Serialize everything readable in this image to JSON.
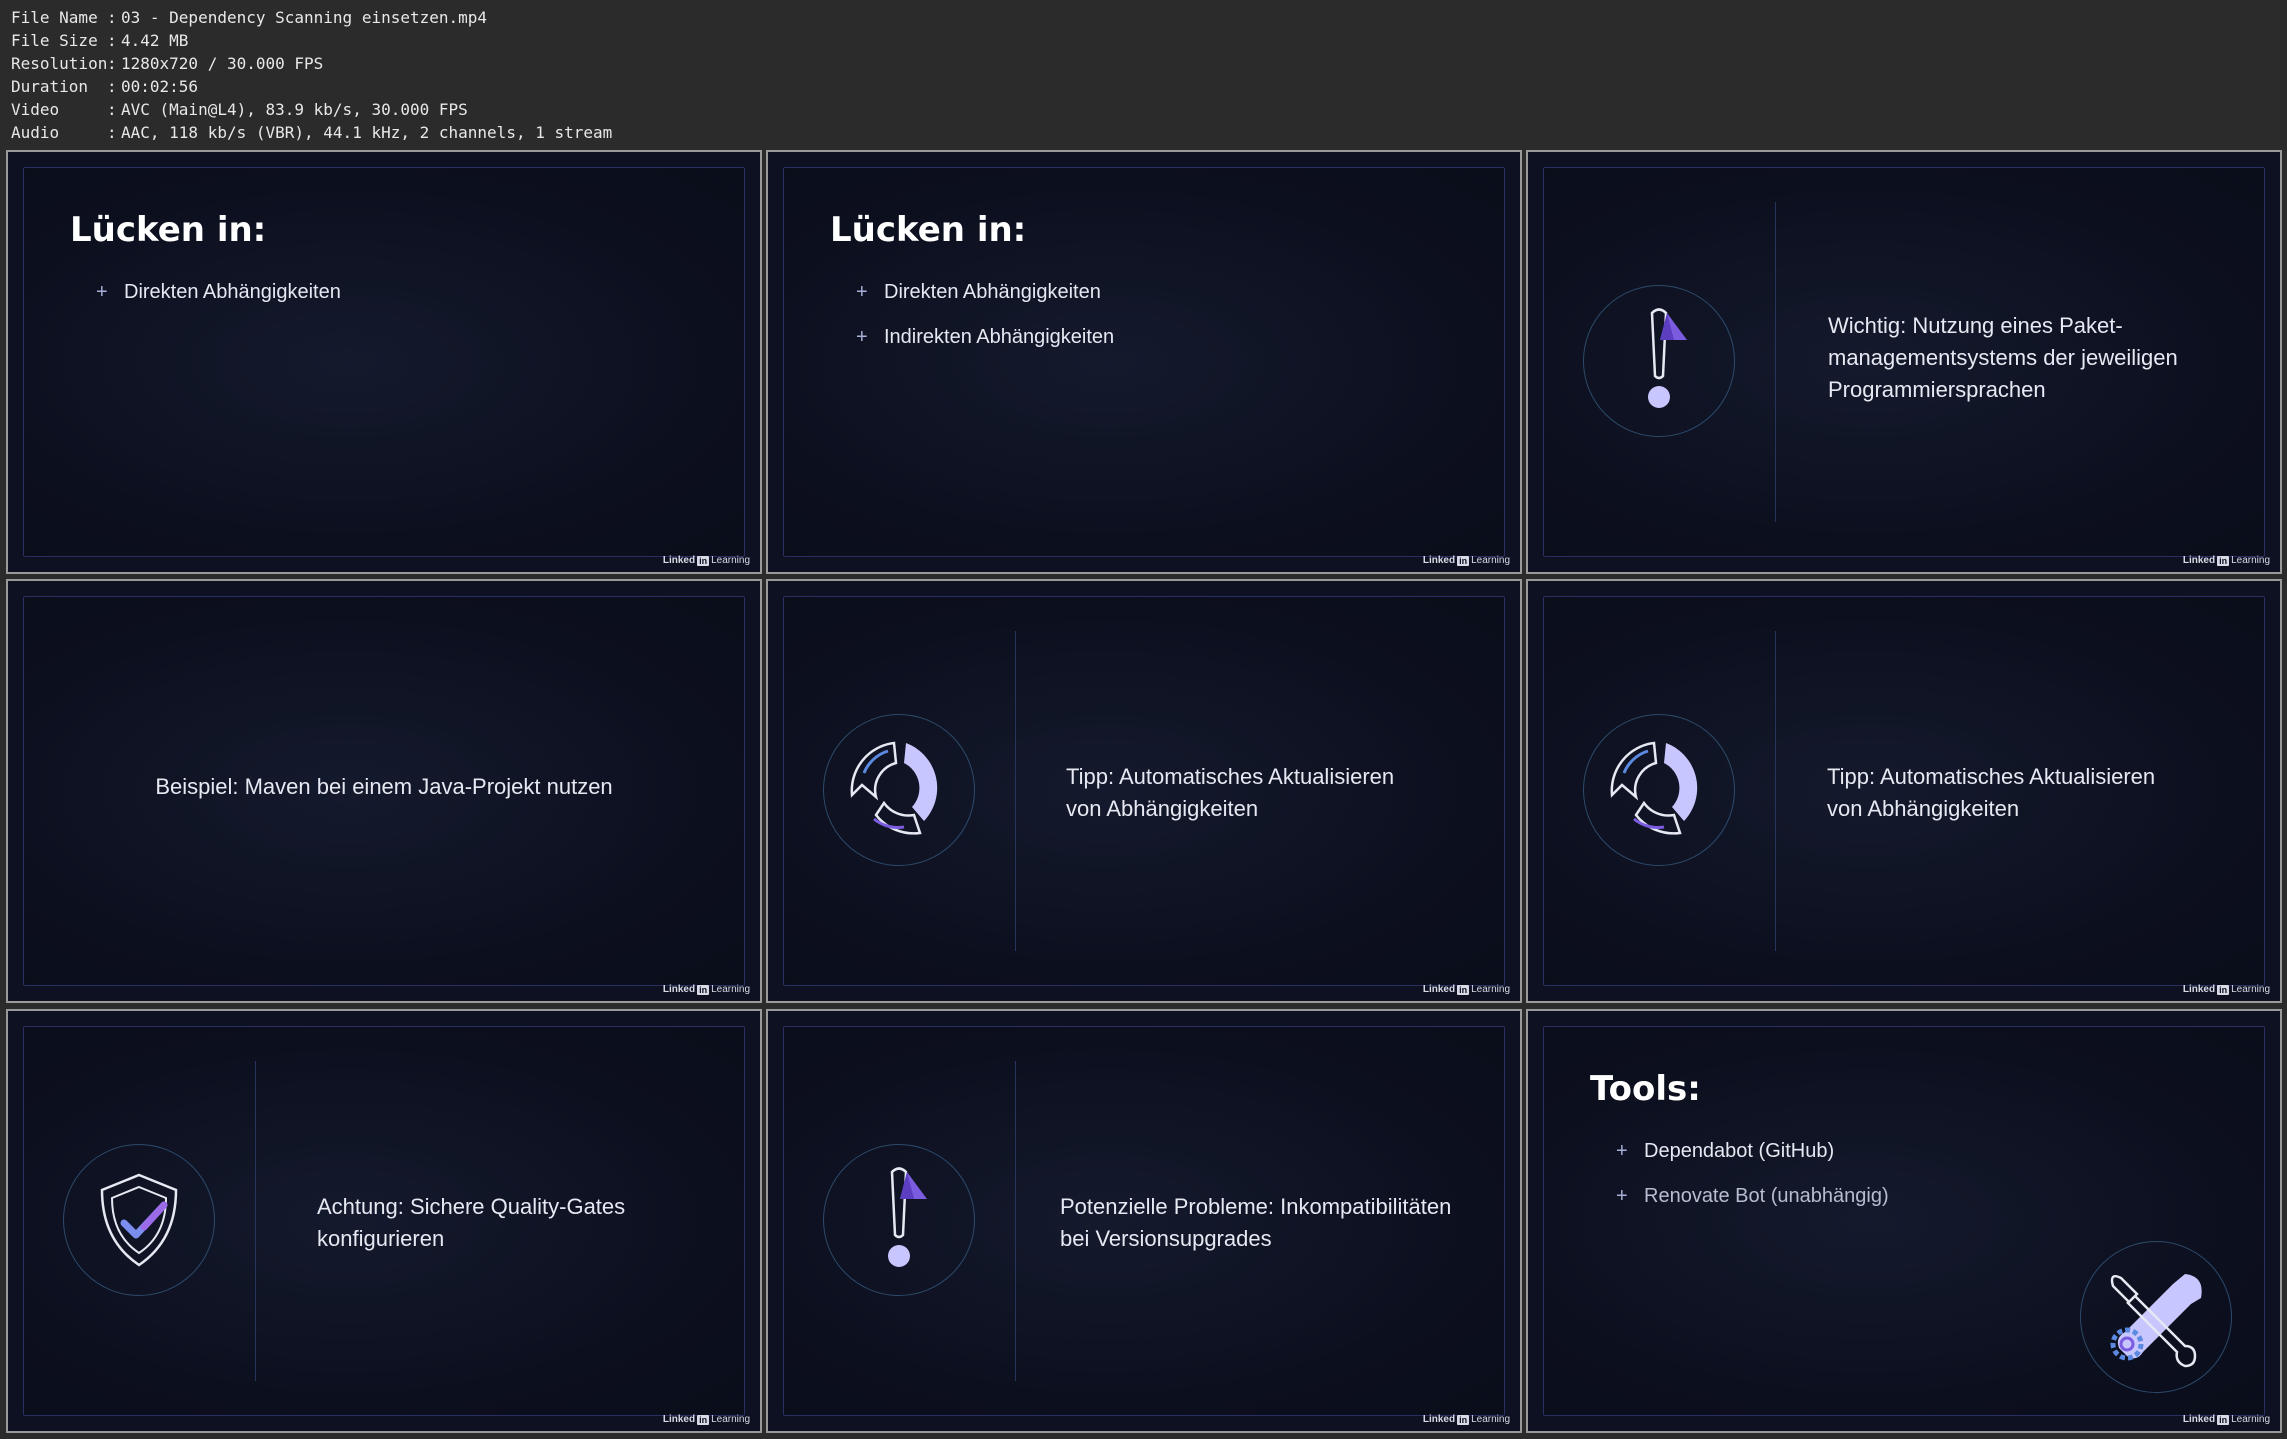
{
  "metadata": [
    {
      "key": "File Name",
      "sep": ":",
      "value": "03 - Dependency Scanning einsetzen.mp4"
    },
    {
      "key": "File Size",
      "sep": ":",
      "value": "4.42 MB"
    },
    {
      "key": "Resolution",
      "sep": ":",
      "value": "1280x720 / 30.000 FPS"
    },
    {
      "key": "Duration",
      "sep": ":",
      "value": "00:02:56"
    },
    {
      "key": "Video",
      "sep": ":",
      "value": "AVC (Main@L4), 83.9 kb/s, 30.000 FPS"
    },
    {
      "key": "Audio",
      "sep": ":",
      "value": "AAC, 118 kb/s (VBR), 44.1 kHz, 2 channels, 1 stream"
    }
  ],
  "brand": {
    "linked": "Linked",
    "in": "in",
    "learning": "Learning"
  },
  "tiles": {
    "t1": {
      "title": "Lücken in:",
      "bullets": [
        "Direkten Abhängigkeiten"
      ]
    },
    "t2": {
      "title": "Lücken in:",
      "bullets": [
        "Direkten Abhängigkeiten",
        "Indirekten Abhängigkeiten"
      ]
    },
    "t3": {
      "icon": "exclamation-icon",
      "line1": "Wichtig: Nutzung eines Paket-",
      "line2": "managementsystems der jeweiligen",
      "line3": "Programmiersprachen"
    },
    "t4": {
      "text": "Beispiel: Maven bei einem Java-Projekt nutzen"
    },
    "t5": {
      "icon": "refresh-cycle-icon",
      "line1": "Tipp: Automatisches Aktualisieren",
      "line2": "von Abhängigkeiten"
    },
    "t6": {
      "icon": "refresh-cycle-icon",
      "line1": "Tipp: Automatisches Aktualisieren",
      "line2": "von Abhängigkeiten"
    },
    "t7": {
      "icon": "shield-check-icon",
      "line1": "Achtung: Sichere Quality-Gates",
      "line2": "konfigurieren"
    },
    "t8": {
      "icon": "exclamation-icon",
      "line1": "Potenzielle Probleme: Inkompatibilitäten",
      "line2": "bei Versionsupgrades"
    },
    "t9": {
      "title": "Tools:",
      "bullets": [
        "Dependabot (GitHub)",
        "Renovate Bot (unabhängig)"
      ],
      "icon": "tools-icon"
    }
  }
}
